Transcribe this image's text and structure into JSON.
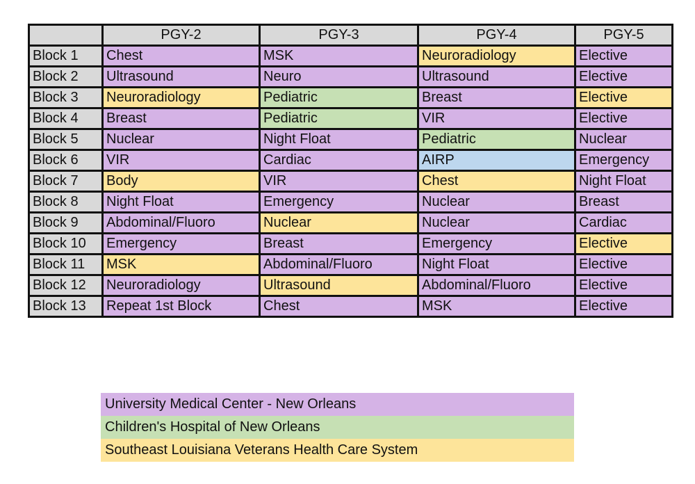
{
  "colors": {
    "UMC": "#d5b3e6",
    "CHNOLA": "#c6e0b4",
    "VA": "#fde49a",
    "AIRP": "#bdd7ee",
    "header": "#d9d9d9"
  },
  "table": {
    "headers": [
      "",
      "PGY-2",
      "PGY-3",
      "PGY-4",
      "PGY-5"
    ],
    "rows": [
      {
        "label": "Block 1",
        "cells": [
          [
            "Chest",
            "UMC"
          ],
          [
            "MSK",
            "UMC"
          ],
          [
            "Neuroradiology",
            "VA"
          ],
          [
            "Elective",
            "UMC"
          ]
        ]
      },
      {
        "label": "Block 2",
        "cells": [
          [
            "Ultrasound",
            "UMC"
          ],
          [
            "Neuro",
            "UMC"
          ],
          [
            "Ultrasound",
            "UMC"
          ],
          [
            "Elective",
            "UMC"
          ]
        ]
      },
      {
        "label": "Block 3",
        "cells": [
          [
            "Neuroradiology",
            "VA"
          ],
          [
            "Pediatric",
            "CHNOLA"
          ],
          [
            "Breast",
            "UMC"
          ],
          [
            "Elective",
            "VA"
          ]
        ]
      },
      {
        "label": "Block 4",
        "cells": [
          [
            "Breast",
            "UMC"
          ],
          [
            "Pediatric",
            "CHNOLA"
          ],
          [
            "VIR",
            "UMC"
          ],
          [
            "Elective",
            "UMC"
          ]
        ]
      },
      {
        "label": "Block 5",
        "cells": [
          [
            "Nuclear",
            "UMC"
          ],
          [
            "Night Float",
            "UMC"
          ],
          [
            "Pediatric",
            "CHNOLA"
          ],
          [
            "Nuclear",
            "UMC"
          ]
        ]
      },
      {
        "label": "Block 6",
        "cells": [
          [
            "VIR",
            "UMC"
          ],
          [
            "Cardiac",
            "UMC"
          ],
          [
            "AIRP",
            "AIRP"
          ],
          [
            "Emergency",
            "UMC"
          ]
        ]
      },
      {
        "label": "Block 7",
        "cells": [
          [
            "Body",
            "VA"
          ],
          [
            "VIR",
            "UMC"
          ],
          [
            "Chest",
            "VA"
          ],
          [
            "Night Float",
            "UMC"
          ]
        ]
      },
      {
        "label": "Block 8",
        "cells": [
          [
            "Night Float",
            "UMC"
          ],
          [
            "Emergency",
            "UMC"
          ],
          [
            "Nuclear",
            "UMC"
          ],
          [
            "Breast",
            "UMC"
          ]
        ]
      },
      {
        "label": "Block 9",
        "cells": [
          [
            "Abdominal/Fluoro",
            "UMC"
          ],
          [
            "Nuclear",
            "VA"
          ],
          [
            "Nuclear",
            "UMC"
          ],
          [
            "Cardiac",
            "UMC"
          ]
        ]
      },
      {
        "label": "Block 10",
        "cells": [
          [
            "Emergency",
            "UMC"
          ],
          [
            "Breast",
            "UMC"
          ],
          [
            "Emergency",
            "UMC"
          ],
          [
            "Elective",
            "VA"
          ]
        ]
      },
      {
        "label": "Block 11",
        "cells": [
          [
            "MSK",
            "VA"
          ],
          [
            "Abdominal/Fluoro",
            "UMC"
          ],
          [
            "Night Float",
            "UMC"
          ],
          [
            "Elective",
            "UMC"
          ]
        ]
      },
      {
        "label": "Block 12",
        "cells": [
          [
            "Neuroradiology",
            "UMC"
          ],
          [
            "Ultrasound",
            "VA"
          ],
          [
            "Abdominal/Fluoro",
            "UMC"
          ],
          [
            "Elective",
            "UMC"
          ]
        ]
      },
      {
        "label": "Block 13",
        "cells": [
          [
            "Repeat 1st Block",
            "UMC"
          ],
          [
            "Chest",
            "UMC"
          ],
          [
            "MSK",
            "UMC"
          ],
          [
            "Elective",
            "UMC"
          ]
        ]
      }
    ]
  },
  "legend": [
    {
      "label": "University Medical Center - New Orleans",
      "site": "UMC"
    },
    {
      "label": "Children's Hospital of New Orleans",
      "site": "CHNOLA"
    },
    {
      "label": "Southeast Louisiana Veterans Health Care System",
      "site": "VA"
    }
  ]
}
